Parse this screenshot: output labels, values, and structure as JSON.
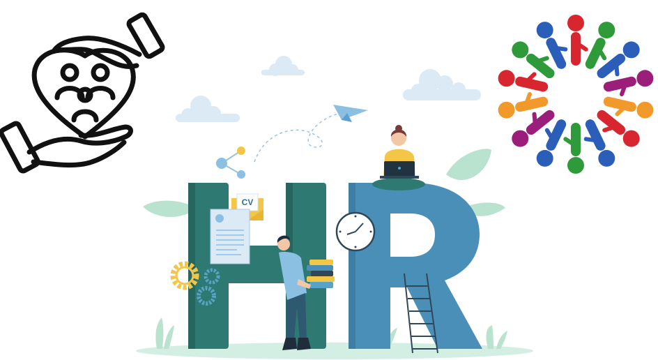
{
  "illustration": {
    "letters": "HR",
    "cv_label": "CV"
  },
  "colors": {
    "h_letter": "#2e7a73",
    "r_letter": "#4a8fb7",
    "leaf": "#b9e3cf",
    "cloud": "#dbeaf5",
    "gear": "#f3c648",
    "gear_blue": "#5aa3c8",
    "ground": "#d3eee3"
  },
  "icons": {
    "left": "hands-holding-family-icon",
    "right": "people-circle-unity-icon"
  },
  "people_circle_colors": [
    "#d7262f",
    "#2f9a3a",
    "#2b5eb8",
    "#9b1f7a",
    "#f19a2b",
    "#d7262f",
    "#2b5eb8",
    "#2f9a3a",
    "#2b5eb8",
    "#9b1f7a",
    "#f19a2b",
    "#d7262f",
    "#2f9a3a",
    "#2b5eb8"
  ]
}
